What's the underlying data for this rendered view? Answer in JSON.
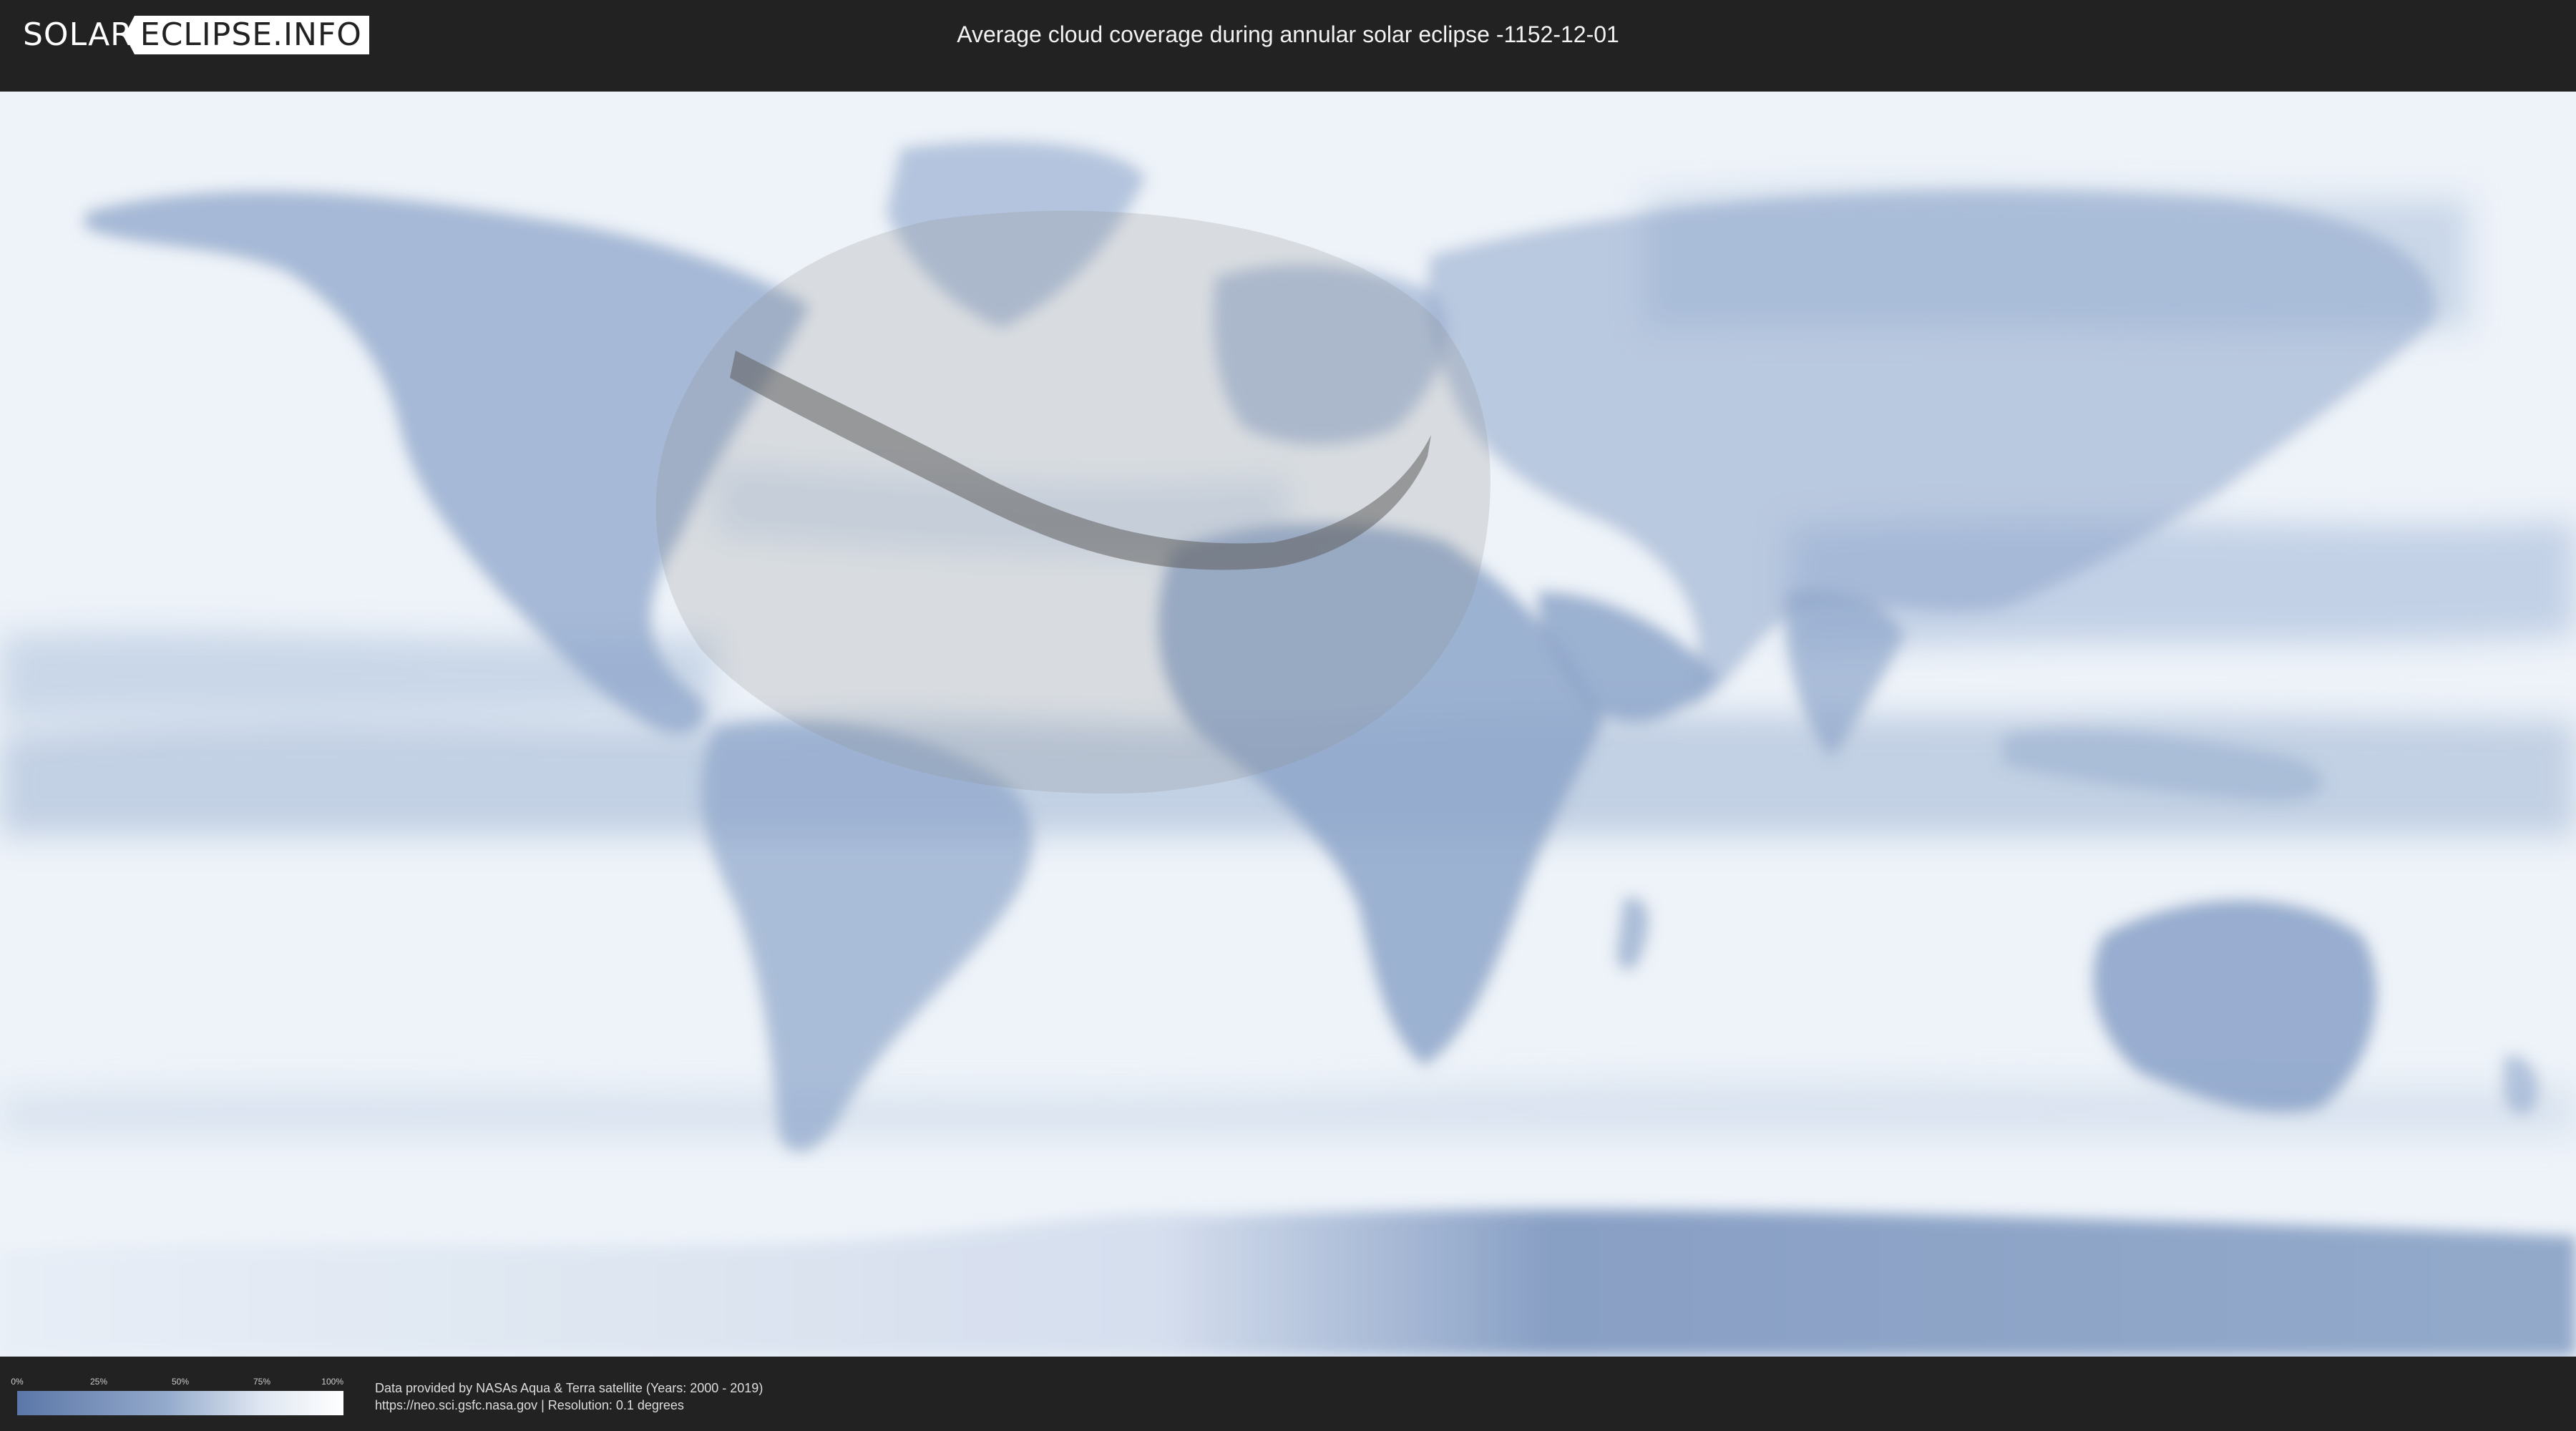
{
  "header": {
    "logo_left": "SOLAR",
    "logo_right": "ECLIPSE.INFO",
    "title": "Average cloud coverage during annular solar eclipse -1152-12-01"
  },
  "map": {
    "colors": {
      "clear_sky": "#5b77a8",
      "overcast": "#ffffff",
      "land_border": "#8a96a8",
      "eclipse_zone": "#8f8f8f",
      "path_of_annularity": "#6d6d6d"
    }
  },
  "legend": {
    "ticks": [
      "0%",
      "25%",
      "50%",
      "75%",
      "100%"
    ],
    "gradient": [
      "#5b77a8",
      "#93a9cb",
      "#dfe7f2",
      "#ffffff"
    ]
  },
  "footer": {
    "credit_line1": "Data provided by NASAs Aqua & Terra satellite (Years: 2000 - 2019)",
    "credit_line2": "https://neo.sci.gsfc.nasa.gov | Resolution: 0.1 degrees"
  }
}
